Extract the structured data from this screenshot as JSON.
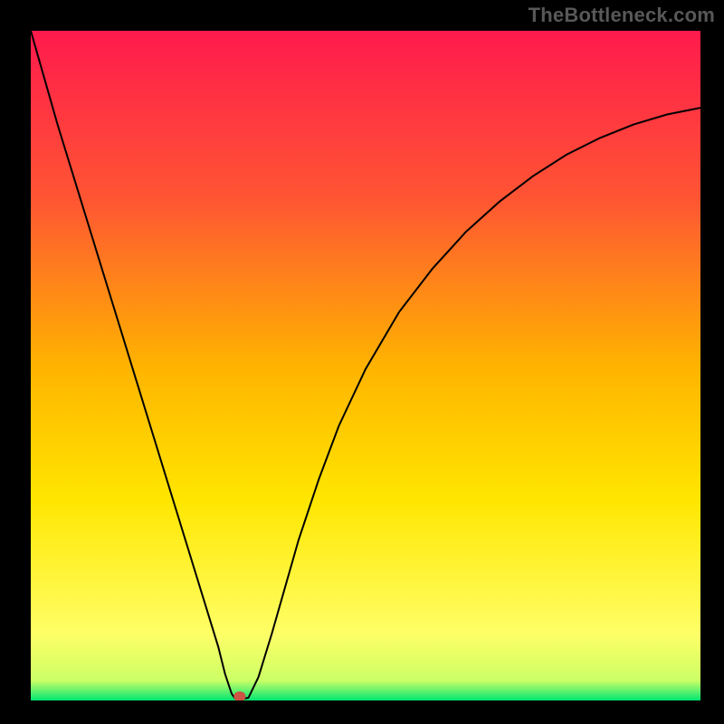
{
  "attribution": "TheBottleneck.com",
  "chart_data": {
    "type": "line",
    "title": "",
    "xlabel": "",
    "ylabel": "",
    "xlim": [
      0,
      100
    ],
    "ylim": [
      0,
      100
    ],
    "grid": false,
    "legend": false,
    "background_gradient": {
      "stops": [
        {
          "offset": 0.0,
          "color": "#ff1a4d"
        },
        {
          "offset": 0.25,
          "color": "#ff5533"
        },
        {
          "offset": 0.5,
          "color": "#ffb300"
        },
        {
          "offset": 0.7,
          "color": "#ffe600"
        },
        {
          "offset": 0.9,
          "color": "#ffff66"
        },
        {
          "offset": 0.97,
          "color": "#ccff66"
        },
        {
          "offset": 1.0,
          "color": "#00e673"
        }
      ]
    },
    "curve": {
      "color": "#000000",
      "width": 2,
      "points": [
        {
          "x": 0.0,
          "y": 100.0
        },
        {
          "x": 2.0,
          "y": 93.0
        },
        {
          "x": 4.0,
          "y": 86.0
        },
        {
          "x": 6.0,
          "y": 79.5
        },
        {
          "x": 8.0,
          "y": 73.0
        },
        {
          "x": 10.0,
          "y": 66.5
        },
        {
          "x": 12.0,
          "y": 60.0
        },
        {
          "x": 14.0,
          "y": 53.5
        },
        {
          "x": 16.0,
          "y": 47.0
        },
        {
          "x": 18.0,
          "y": 40.5
        },
        {
          "x": 20.0,
          "y": 34.0
        },
        {
          "x": 22.0,
          "y": 27.5
        },
        {
          "x": 24.0,
          "y": 21.0
        },
        {
          "x": 26.0,
          "y": 14.5
        },
        {
          "x": 28.0,
          "y": 8.0
        },
        {
          "x": 29.0,
          "y": 4.0
        },
        {
          "x": 30.0,
          "y": 1.0
        },
        {
          "x": 30.5,
          "y": 0.3
        },
        {
          "x": 31.5,
          "y": 0.2
        },
        {
          "x": 32.5,
          "y": 0.4
        },
        {
          "x": 34.0,
          "y": 3.5
        },
        {
          "x": 36.0,
          "y": 10.0
        },
        {
          "x": 38.0,
          "y": 17.0
        },
        {
          "x": 40.0,
          "y": 24.0
        },
        {
          "x": 43.0,
          "y": 33.0
        },
        {
          "x": 46.0,
          "y": 41.0
        },
        {
          "x": 50.0,
          "y": 49.5
        },
        {
          "x": 55.0,
          "y": 58.0
        },
        {
          "x": 60.0,
          "y": 64.5
        },
        {
          "x": 65.0,
          "y": 70.0
        },
        {
          "x": 70.0,
          "y": 74.5
        },
        {
          "x": 75.0,
          "y": 78.3
        },
        {
          "x": 80.0,
          "y": 81.5
        },
        {
          "x": 85.0,
          "y": 84.0
        },
        {
          "x": 90.0,
          "y": 86.0
        },
        {
          "x": 95.0,
          "y": 87.5
        },
        {
          "x": 100.0,
          "y": 88.5
        }
      ]
    },
    "marker": {
      "x": 31.2,
      "y": 0.6,
      "rx": 0.9,
      "ry": 0.75,
      "color": "#cc5544"
    }
  }
}
